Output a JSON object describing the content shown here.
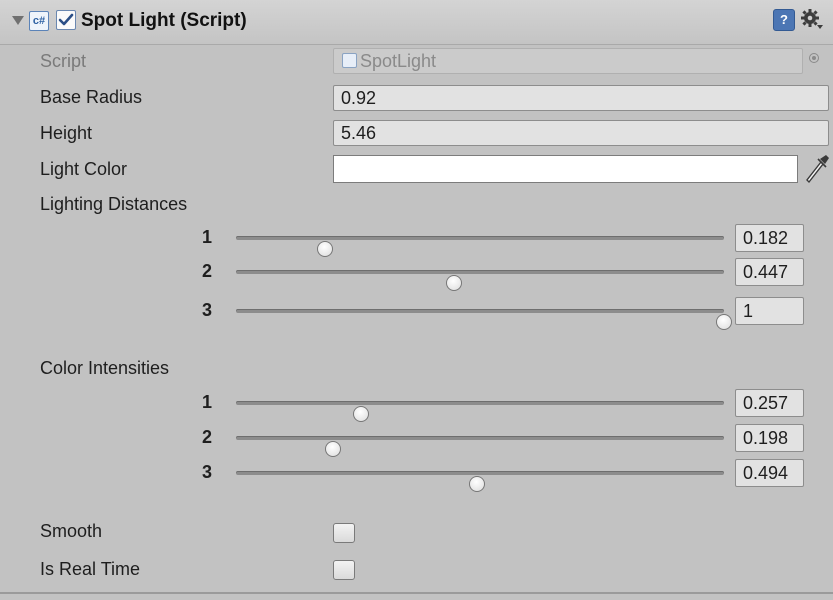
{
  "component": {
    "title": "Spot Light (Script)",
    "enabled": true,
    "help_glyph": "?",
    "script_icon_glyph": "c#"
  },
  "script_field": {
    "label": "Script",
    "value": "SpotLight"
  },
  "base_radius": {
    "label": "Base Radius",
    "value": "0.92"
  },
  "height": {
    "label": "Height",
    "value": "5.46"
  },
  "light_color": {
    "label": "Light Color",
    "color": "#ffffff"
  },
  "lighting_distances": {
    "label": "Lighting Distances",
    "items": [
      {
        "index": "1",
        "value": "0.182",
        "fraction": 0.182
      },
      {
        "index": "2",
        "value": "0.447",
        "fraction": 0.447
      },
      {
        "index": "3",
        "value": "1",
        "fraction": 1.0
      }
    ]
  },
  "color_intensities": {
    "label": "Color Intensities",
    "items": [
      {
        "index": "1",
        "value": "0.257",
        "fraction": 0.257
      },
      {
        "index": "2",
        "value": "0.198",
        "fraction": 0.198
      },
      {
        "index": "3",
        "value": "0.494",
        "fraction": 0.494
      }
    ]
  },
  "smooth": {
    "label": "Smooth",
    "checked": false
  },
  "is_real_time": {
    "label": "Is Real Time",
    "checked": false
  },
  "icons": [
    "foldout-arrow-icon",
    "script-icon",
    "checkbox-icon",
    "help-icon",
    "gear-icon",
    "object-picker-icon",
    "eyedropper-icon"
  ]
}
